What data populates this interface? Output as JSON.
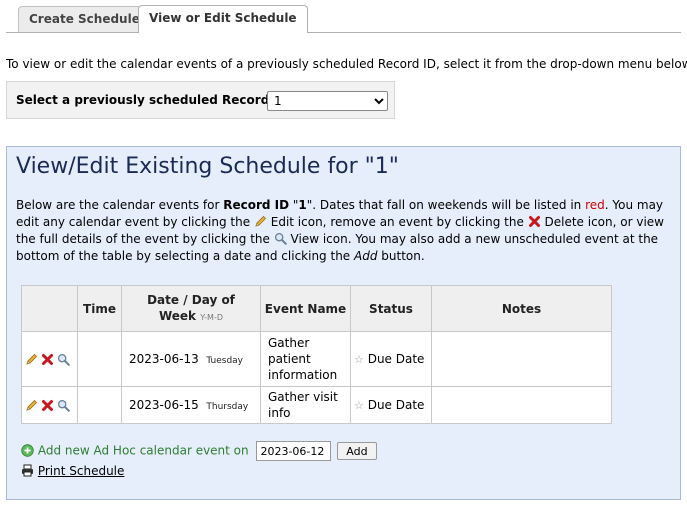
{
  "tabs": [
    {
      "label": "Create Schedule"
    },
    {
      "label": "View or Edit Schedule",
      "active": true
    }
  ],
  "intro_text": "To view or edit the calendar events of a previously scheduled Record ID, select it from the drop-down menu below.",
  "record_select": {
    "label": "Select a previously scheduled Record ID:",
    "selected": "1"
  },
  "panel": {
    "title": "View/Edit Existing Schedule for \"1\"",
    "desc": {
      "p1": "Below are the calendar events for ",
      "record_label": "Record ID",
      "p2": " \"",
      "record_id": "1",
      "p3": "\". Dates that fall on weekends will be listed in ",
      "red_word": "red",
      "p4": ". You may edit any calendar event by clicking the ",
      "edit_label": " Edit icon, remove an event by clicking the ",
      "delete_label": " Delete icon, or view the full details of the event by clicking the ",
      "view_label": " View icon. You may also add a new unscheduled event at the bottom of the table by selecting a date and clicking the ",
      "add_word": "Add",
      "p5": " button."
    }
  },
  "table": {
    "headers": {
      "time": "Time",
      "date": "Date / Day of Week",
      "date_format": "Y-M-D",
      "event_name": "Event Name",
      "status": "Status",
      "notes": "Notes"
    },
    "rows": [
      {
        "date": "2023-06-13",
        "day": "Tuesday",
        "event_name": "Gather patient information",
        "status": "Due Date",
        "time": "",
        "notes": ""
      },
      {
        "date": "2023-06-15",
        "day": "Thursday",
        "event_name": "Gather visit info",
        "status": "Due Date",
        "time": "",
        "notes": ""
      }
    ]
  },
  "adhoc": {
    "label": "Add new Ad Hoc calendar event on",
    "date_value": "2023-06-12",
    "button": "Add"
  },
  "print_link": "Print Schedule",
  "icons": {
    "edit": "pencil-icon",
    "delete": "red-x-icon",
    "view": "magnifier-icon",
    "status": "star-icon",
    "add": "green-plus-icon",
    "print": "printer-icon"
  },
  "colors": {
    "panel_bg": "#e6eefb",
    "title": "#1a2a55",
    "weekend": "#cc0000",
    "adhoc": "#2e7d32"
  }
}
